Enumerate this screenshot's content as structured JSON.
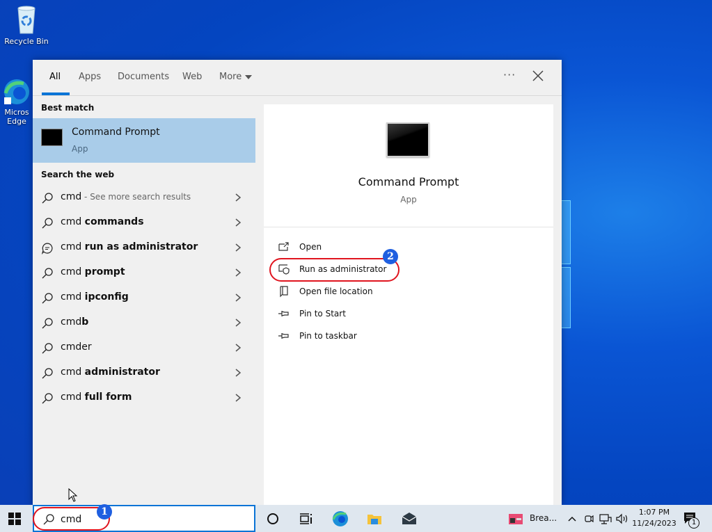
{
  "desktop": {
    "icons": [
      {
        "label": "Recycle Bin",
        "icon": "recycle-bin-icon"
      },
      {
        "label": "Micros\nEdge",
        "icon": "edge-icon"
      }
    ]
  },
  "search_panel": {
    "tabs": [
      {
        "label": "All",
        "active": true
      },
      {
        "label": "Apps",
        "active": false
      },
      {
        "label": "Documents",
        "active": false
      },
      {
        "label": "Web",
        "active": false
      },
      {
        "label": "More",
        "active": false
      }
    ],
    "more_options_label": "···",
    "best_match": {
      "heading": "Best match",
      "title": "Command Prompt",
      "subtitle": "App"
    },
    "search_web": {
      "heading": "Search the web",
      "items": [
        {
          "prefix": "cmd",
          "bold": "",
          "hint": " - See more search results",
          "icon": "search-icon"
        },
        {
          "prefix": "cmd ",
          "bold": "commands",
          "hint": "",
          "icon": "search-icon"
        },
        {
          "prefix": "cmd ",
          "bold": "run as administrator",
          "hint": "",
          "icon": "chat-icon"
        },
        {
          "prefix": "cmd ",
          "bold": "prompt",
          "hint": "",
          "icon": "search-icon"
        },
        {
          "prefix": "cmd ",
          "bold": "ipconfig",
          "hint": "",
          "icon": "search-icon"
        },
        {
          "prefix": "cmd",
          "bold": "b",
          "hint": "",
          "icon": "search-icon"
        },
        {
          "prefix": "cmder",
          "bold": "",
          "hint": "",
          "icon": "search-icon"
        },
        {
          "prefix": "cmd ",
          "bold": "administrator",
          "hint": "",
          "icon": "search-icon"
        },
        {
          "prefix": "cmd ",
          "bold": "full form",
          "hint": "",
          "icon": "search-icon"
        }
      ]
    },
    "preview": {
      "title": "Command Prompt",
      "subtitle": "App",
      "actions": [
        {
          "label": "Open",
          "icon": "open-icon"
        },
        {
          "label": "Run as administrator",
          "icon": "shield-icon"
        },
        {
          "label": "Open file location",
          "icon": "file-location-icon"
        },
        {
          "label": "Pin to Start",
          "icon": "pin-icon"
        },
        {
          "label": "Pin to taskbar",
          "icon": "pin-icon"
        }
      ]
    }
  },
  "annotations": [
    {
      "number": "1",
      "target": "search-box"
    },
    {
      "number": "2",
      "target": "run-as-administrator"
    }
  ],
  "taskbar": {
    "search_value": "cmd",
    "running_app_label": "Brea...",
    "clock_time": "1:07 PM",
    "clock_date": "11/24/2023",
    "notification_count": "1"
  },
  "colors": {
    "accent": "#0a74d6",
    "selection": "#a9cce9",
    "annotation_red": "#e0141e",
    "annotation_badge": "#1f5fe0"
  }
}
